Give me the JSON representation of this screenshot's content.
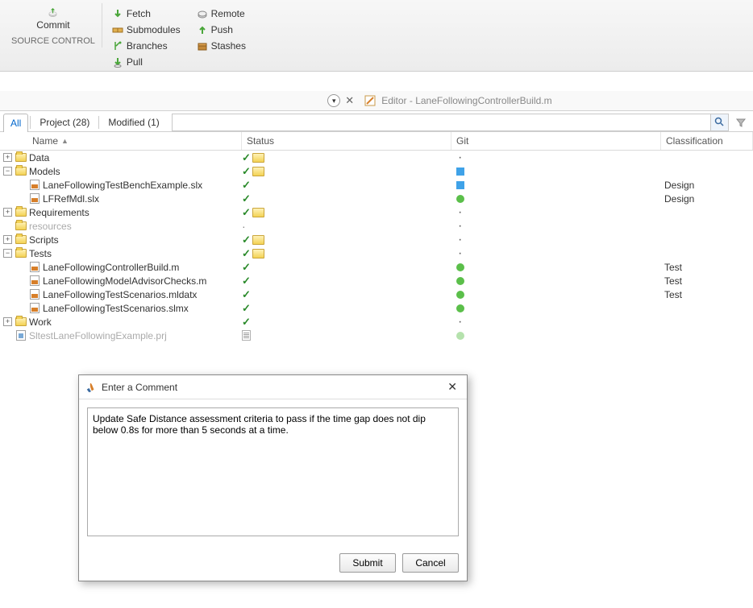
{
  "ribbon": {
    "commit": "Commit",
    "fetch": "Fetch",
    "push": "Push",
    "pull": "Pull",
    "remote": "Remote",
    "branches": "Branches",
    "submodules": "Submodules",
    "stashes": "Stashes",
    "group_label": "SOURCE CONTROL"
  },
  "editor": {
    "prefix": "Editor - ",
    "file": "LaneFollowingControllerBuild.m"
  },
  "filters": {
    "all": "All",
    "project": "Project (28)",
    "modified": "Modified (1)"
  },
  "columns": {
    "name": "Name",
    "status": "Status",
    "git": "Git",
    "classification": "Classification"
  },
  "rows": [
    {
      "exp": "plus",
      "depth": 0,
      "icon": "folder",
      "label": "Data",
      "status": "check-folder",
      "git": "dot",
      "class": ""
    },
    {
      "exp": "minus",
      "depth": 0,
      "icon": "folder",
      "label": "Models",
      "status": "check-folder",
      "git": "sq",
      "class": ""
    },
    {
      "exp": "",
      "depth": 1,
      "icon": "filemat",
      "label": "LaneFollowingTestBenchExample.slx",
      "status": "check",
      "git": "sq",
      "class": "Design"
    },
    {
      "exp": "",
      "depth": 1,
      "icon": "filemat",
      "label": "LFRefMdl.slx",
      "status": "check",
      "git": "green",
      "class": "Design"
    },
    {
      "exp": "plus",
      "depth": 0,
      "icon": "folder",
      "label": "Requirements",
      "status": "check-folder",
      "git": "dot",
      "class": ""
    },
    {
      "exp": "",
      "depth": 0,
      "icon": "folder",
      "label": "resources",
      "status": "tinydot",
      "git": "dot",
      "class": "",
      "muted": true
    },
    {
      "exp": "plus",
      "depth": 0,
      "icon": "folder",
      "label": "Scripts",
      "status": "check-folder",
      "git": "dot",
      "class": ""
    },
    {
      "exp": "minus",
      "depth": 0,
      "icon": "folder",
      "label": "Tests",
      "status": "check-folder",
      "git": "dot",
      "class": ""
    },
    {
      "exp": "",
      "depth": 1,
      "icon": "filemat",
      "label": "LaneFollowingControllerBuild.m",
      "status": "check",
      "git": "green",
      "class": "Test"
    },
    {
      "exp": "",
      "depth": 1,
      "icon": "filemat",
      "label": "LaneFollowingModelAdvisorChecks.m",
      "status": "check",
      "git": "green",
      "class": "Test"
    },
    {
      "exp": "",
      "depth": 1,
      "icon": "filemat",
      "label": "LaneFollowingTestScenarios.mldatx",
      "status": "check",
      "git": "green",
      "class": "Test"
    },
    {
      "exp": "",
      "depth": 1,
      "icon": "filemat",
      "label": "LaneFollowingTestScenarios.slmx",
      "status": "check",
      "git": "green",
      "class": ""
    },
    {
      "exp": "plus",
      "depth": 0,
      "icon": "folder",
      "label": "Work",
      "status": "check",
      "git": "dot",
      "class": ""
    },
    {
      "exp": "",
      "depth": 0,
      "icon": "fileprj",
      "label": "SltestLaneFollowingExample.prj",
      "status": "doc",
      "git": "greenfaded",
      "class": "",
      "muted": true,
      "noexp": true
    }
  ],
  "dialog": {
    "title": "Enter a Comment",
    "text": "Update Safe Distance assessment criteria to pass if the time gap does not dip below 0.8s for more than 5 seconds at a time.",
    "submit": "Submit",
    "cancel": "Cancel"
  }
}
